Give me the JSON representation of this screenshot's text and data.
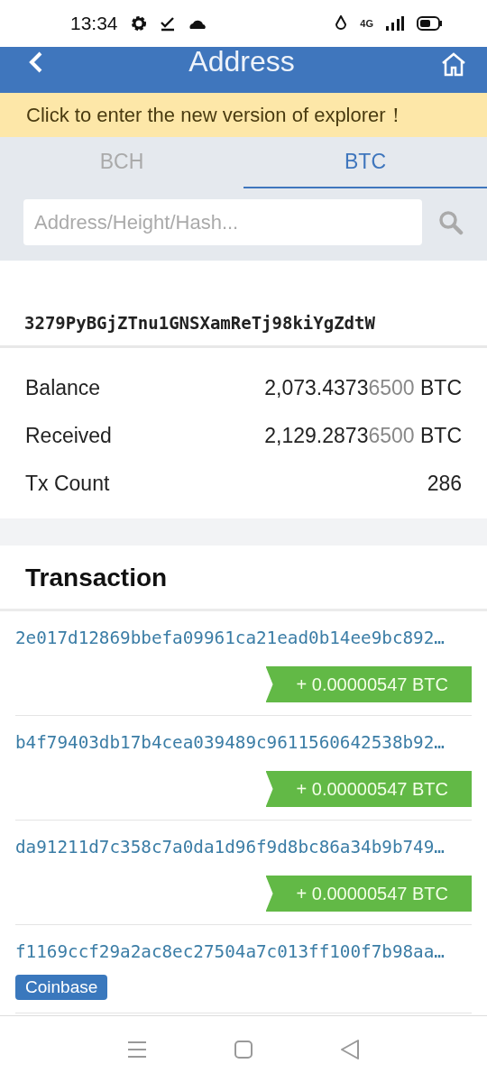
{
  "status_bar": {
    "time": "13:34",
    "network": "4G"
  },
  "header": {
    "title": "Address"
  },
  "banner": {
    "text": "Click to enter the new version of explorer！"
  },
  "tabs": [
    {
      "label": "BCH",
      "selected": false
    },
    {
      "label": "BTC",
      "selected": true
    }
  ],
  "search": {
    "placeholder": "Address/Height/Hash..."
  },
  "address": "3279PyBGjZTnu1GNSXamReTj98kiYgZdtW",
  "stats": [
    {
      "label": "Balance",
      "value": "2,073.4373",
      "value_dim": "6500",
      "unit": "BTC"
    },
    {
      "label": "Received",
      "value": "2,129.2873",
      "value_dim": "6500",
      "unit": "BTC"
    },
    {
      "label": "Tx Count",
      "value": "286"
    }
  ],
  "transactions_title": "Transaction",
  "transactions": [
    {
      "hash": "2e017d12869bbefa09961ca21ead0b14ee9bc892…",
      "kind": "amount",
      "amount": "+ 0.00000547 BTC"
    },
    {
      "hash": "b4f79403db17b4cea039489c9611560642538b92…",
      "kind": "amount",
      "amount": "+ 0.00000547 BTC"
    },
    {
      "hash": "da91211d7c358c7a0da1d96f9d8bc86a34b9b749…",
      "kind": "amount",
      "amount": "+ 0.00000547 BTC"
    },
    {
      "hash": "f1169ccf29a2ac8ec27504a7c013ff100f7b98aa…",
      "kind": "coinbase",
      "tag": "Coinbase"
    }
  ]
}
